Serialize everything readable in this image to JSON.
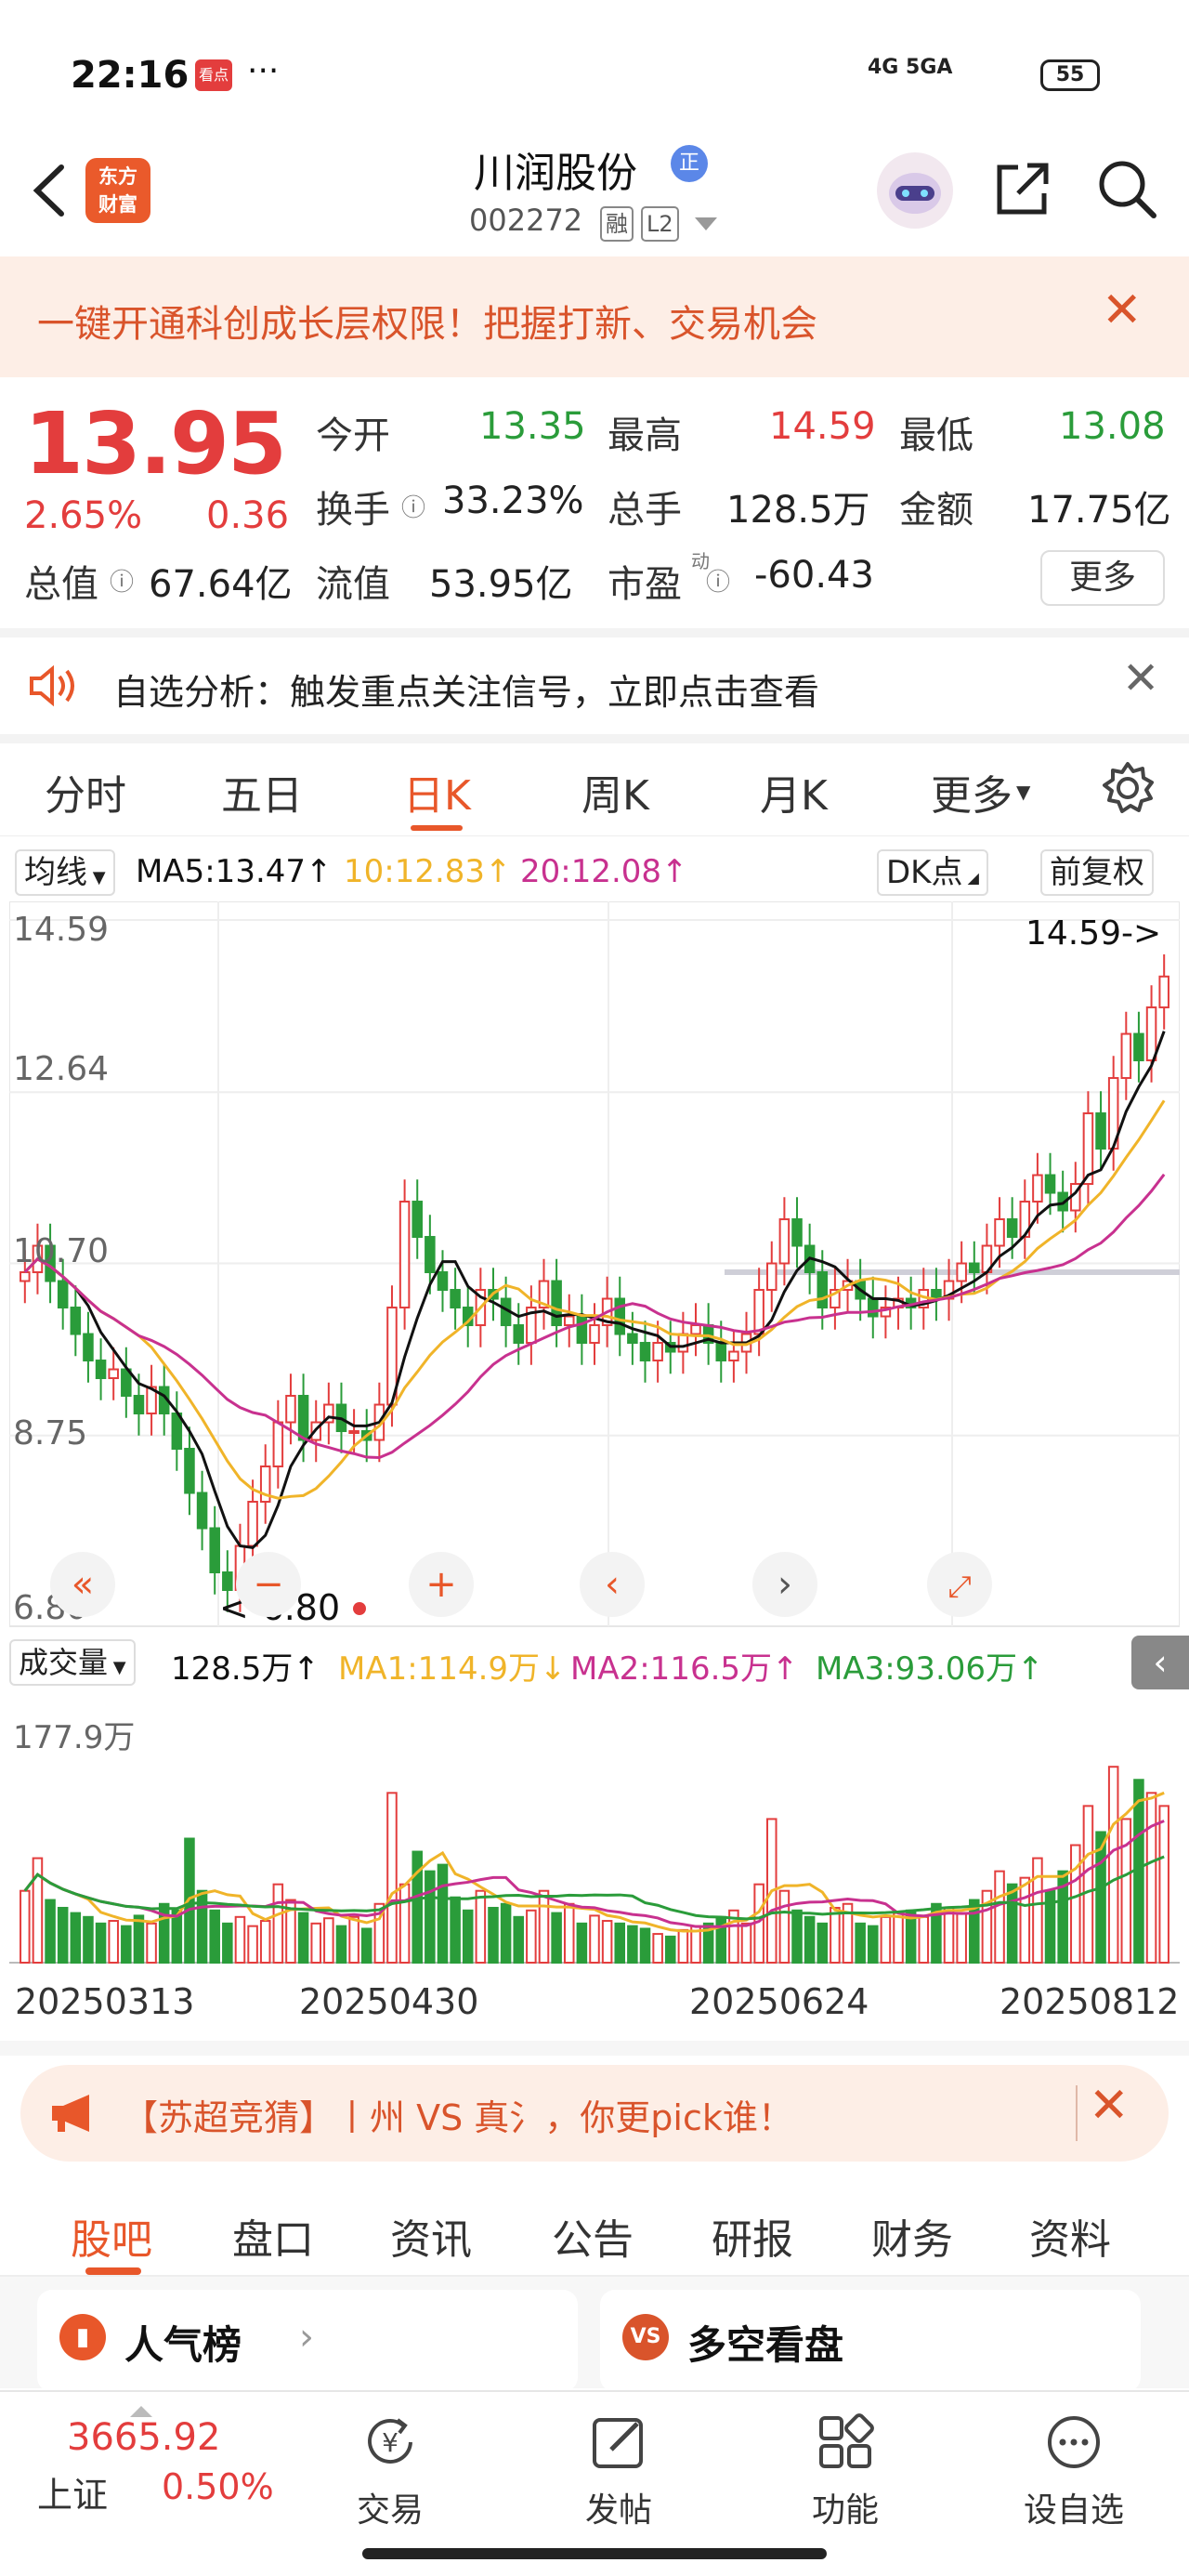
{
  "status": {
    "time": "22:16",
    "notif_badge": "看点",
    "dots": "···",
    "network": "4G 5GA",
    "battery": "55"
  },
  "header": {
    "logo_line1": "东方",
    "logo_line2": "财富",
    "title": "川润股份",
    "title_badge": "正",
    "code": "002272",
    "tag1": "融",
    "tag2": "L2"
  },
  "promo": {
    "text": "一键开通科创成长层权限！把握打新、交易机会",
    "close": "✕"
  },
  "quote": {
    "price": "13.95",
    "pct": "2.65%",
    "change": "0.36",
    "open_label": "今开",
    "open": "13.35",
    "high_label": "最高",
    "high": "14.59",
    "low_label": "最低",
    "low": "13.08",
    "turnover_label": "换手",
    "turnover": "33.23%",
    "volume_label": "总手",
    "volume": "128.5万",
    "amount_label": "金额",
    "amount": "17.75亿",
    "mcap_label": "总值",
    "mcap": "67.64亿",
    "float_label": "流值",
    "float": "53.95亿",
    "pe_label": "市盈",
    "pe_sup": "动",
    "pe": "-60.43",
    "more": "更多"
  },
  "analysis": {
    "text": "自选分析：触发重点关注信号，立即点击查看",
    "close": "✕"
  },
  "period_tabs": [
    "分时",
    "五日",
    "日K",
    "周K",
    "月K",
    "更多"
  ],
  "ma_row": {
    "indicator": "均线",
    "ma5": "MA5:13.47↑",
    "ma10": "10:12.83↑",
    "ma20": "20:12.08↑",
    "dk": "DK点",
    "adjust": "前复权"
  },
  "colors": {
    "up": "#e33d3d",
    "down": "#2a9c3a",
    "accent": "#e8572a",
    "ma5": "#111111",
    "ma10": "#f0b429",
    "ma20": "#c8318f"
  },
  "chart_data": {
    "type": "candlestick",
    "y_ticks": [
      "14.59",
      "12.64",
      "10.70",
      "8.75",
      "6.80"
    ],
    "ylim": [
      6.8,
      14.59
    ],
    "high_label": "14.59->",
    "low_label": "<-6.80",
    "x_labels": [
      "20250313",
      "20250430",
      "20250624",
      "20250812"
    ],
    "closes": [
      10.6,
      10.9,
      10.5,
      10.2,
      9.9,
      9.6,
      9.4,
      9.5,
      9.2,
      9.0,
      9.3,
      9.0,
      8.6,
      8.1,
      7.7,
      7.2,
      7.0,
      7.5,
      8.0,
      8.4,
      8.9,
      9.2,
      8.7,
      8.9,
      9.1,
      8.8,
      8.8,
      8.7,
      9.1,
      10.2,
      11.4,
      11.0,
      10.6,
      10.4,
      10.2,
      10.0,
      10.4,
      10.3,
      10.0,
      9.8,
      10.2,
      10.5,
      10.0,
      10.1,
      9.8,
      10.0,
      10.3,
      9.9,
      9.8,
      9.6,
      9.8,
      9.7,
      9.9,
      10.0,
      9.8,
      9.6,
      9.7,
      9.9,
      10.4,
      10.7,
      11.2,
      10.9,
      10.6,
      10.2,
      10.4,
      10.5,
      10.3,
      10.1,
      10.2,
      10.3,
      10.2,
      10.4,
      10.3,
      10.5,
      10.7,
      10.6,
      10.9,
      11.2,
      11.0,
      11.4,
      11.7,
      11.5,
      11.3,
      11.6,
      12.4,
      12.0,
      12.8,
      13.3,
      13.0,
      13.6,
      13.95
    ],
    "ma_legend": "MA5 / MA10 / MA20"
  },
  "volume": {
    "indicator": "成交量",
    "value": "128.5万↑",
    "ma1": "MA1:114.9万↓",
    "ma2": "MA2:116.5万↑",
    "ma3": "MA3:93.06万↑",
    "max_tick": "177.9万",
    "values": [
      55,
      80,
      48,
      42,
      38,
      35,
      30,
      32,
      28,
      36,
      30,
      45,
      40,
      95,
      55,
      40,
      30,
      35,
      28,
      32,
      60,
      48,
      38,
      30,
      34,
      28,
      35,
      26,
      45,
      130,
      60,
      85,
      70,
      75,
      50,
      40,
      55,
      42,
      45,
      35,
      40,
      55,
      38,
      45,
      30,
      36,
      32,
      30,
      28,
      26,
      22,
      20,
      25,
      28,
      30,
      35,
      40,
      30,
      60,
      110,
      55,
      40,
      35,
      30,
      42,
      45,
      30,
      28,
      35,
      38,
      40,
      35,
      45,
      42,
      38,
      48,
      55,
      70,
      60,
      65,
      80,
      55,
      70,
      90,
      120,
      100,
      150,
      110,
      140,
      130,
      120
    ]
  },
  "ad": {
    "text": "【苏超竞猜】丨州 VS 真氵，你更pick谁！",
    "close": "✕"
  },
  "bottom_tabs": [
    "股吧",
    "盘口",
    "资讯",
    "公告",
    "研报",
    "财务",
    "资料"
  ],
  "cards": {
    "left": "人气榜",
    "right": "多空看盘",
    "right_icon": "VS"
  },
  "bottom_nav": {
    "index_value": "3665.92",
    "index_name": "上证",
    "index_pct": "0.50%",
    "trade": "交易",
    "post": "发帖",
    "func": "功能",
    "watch": "设自选"
  }
}
